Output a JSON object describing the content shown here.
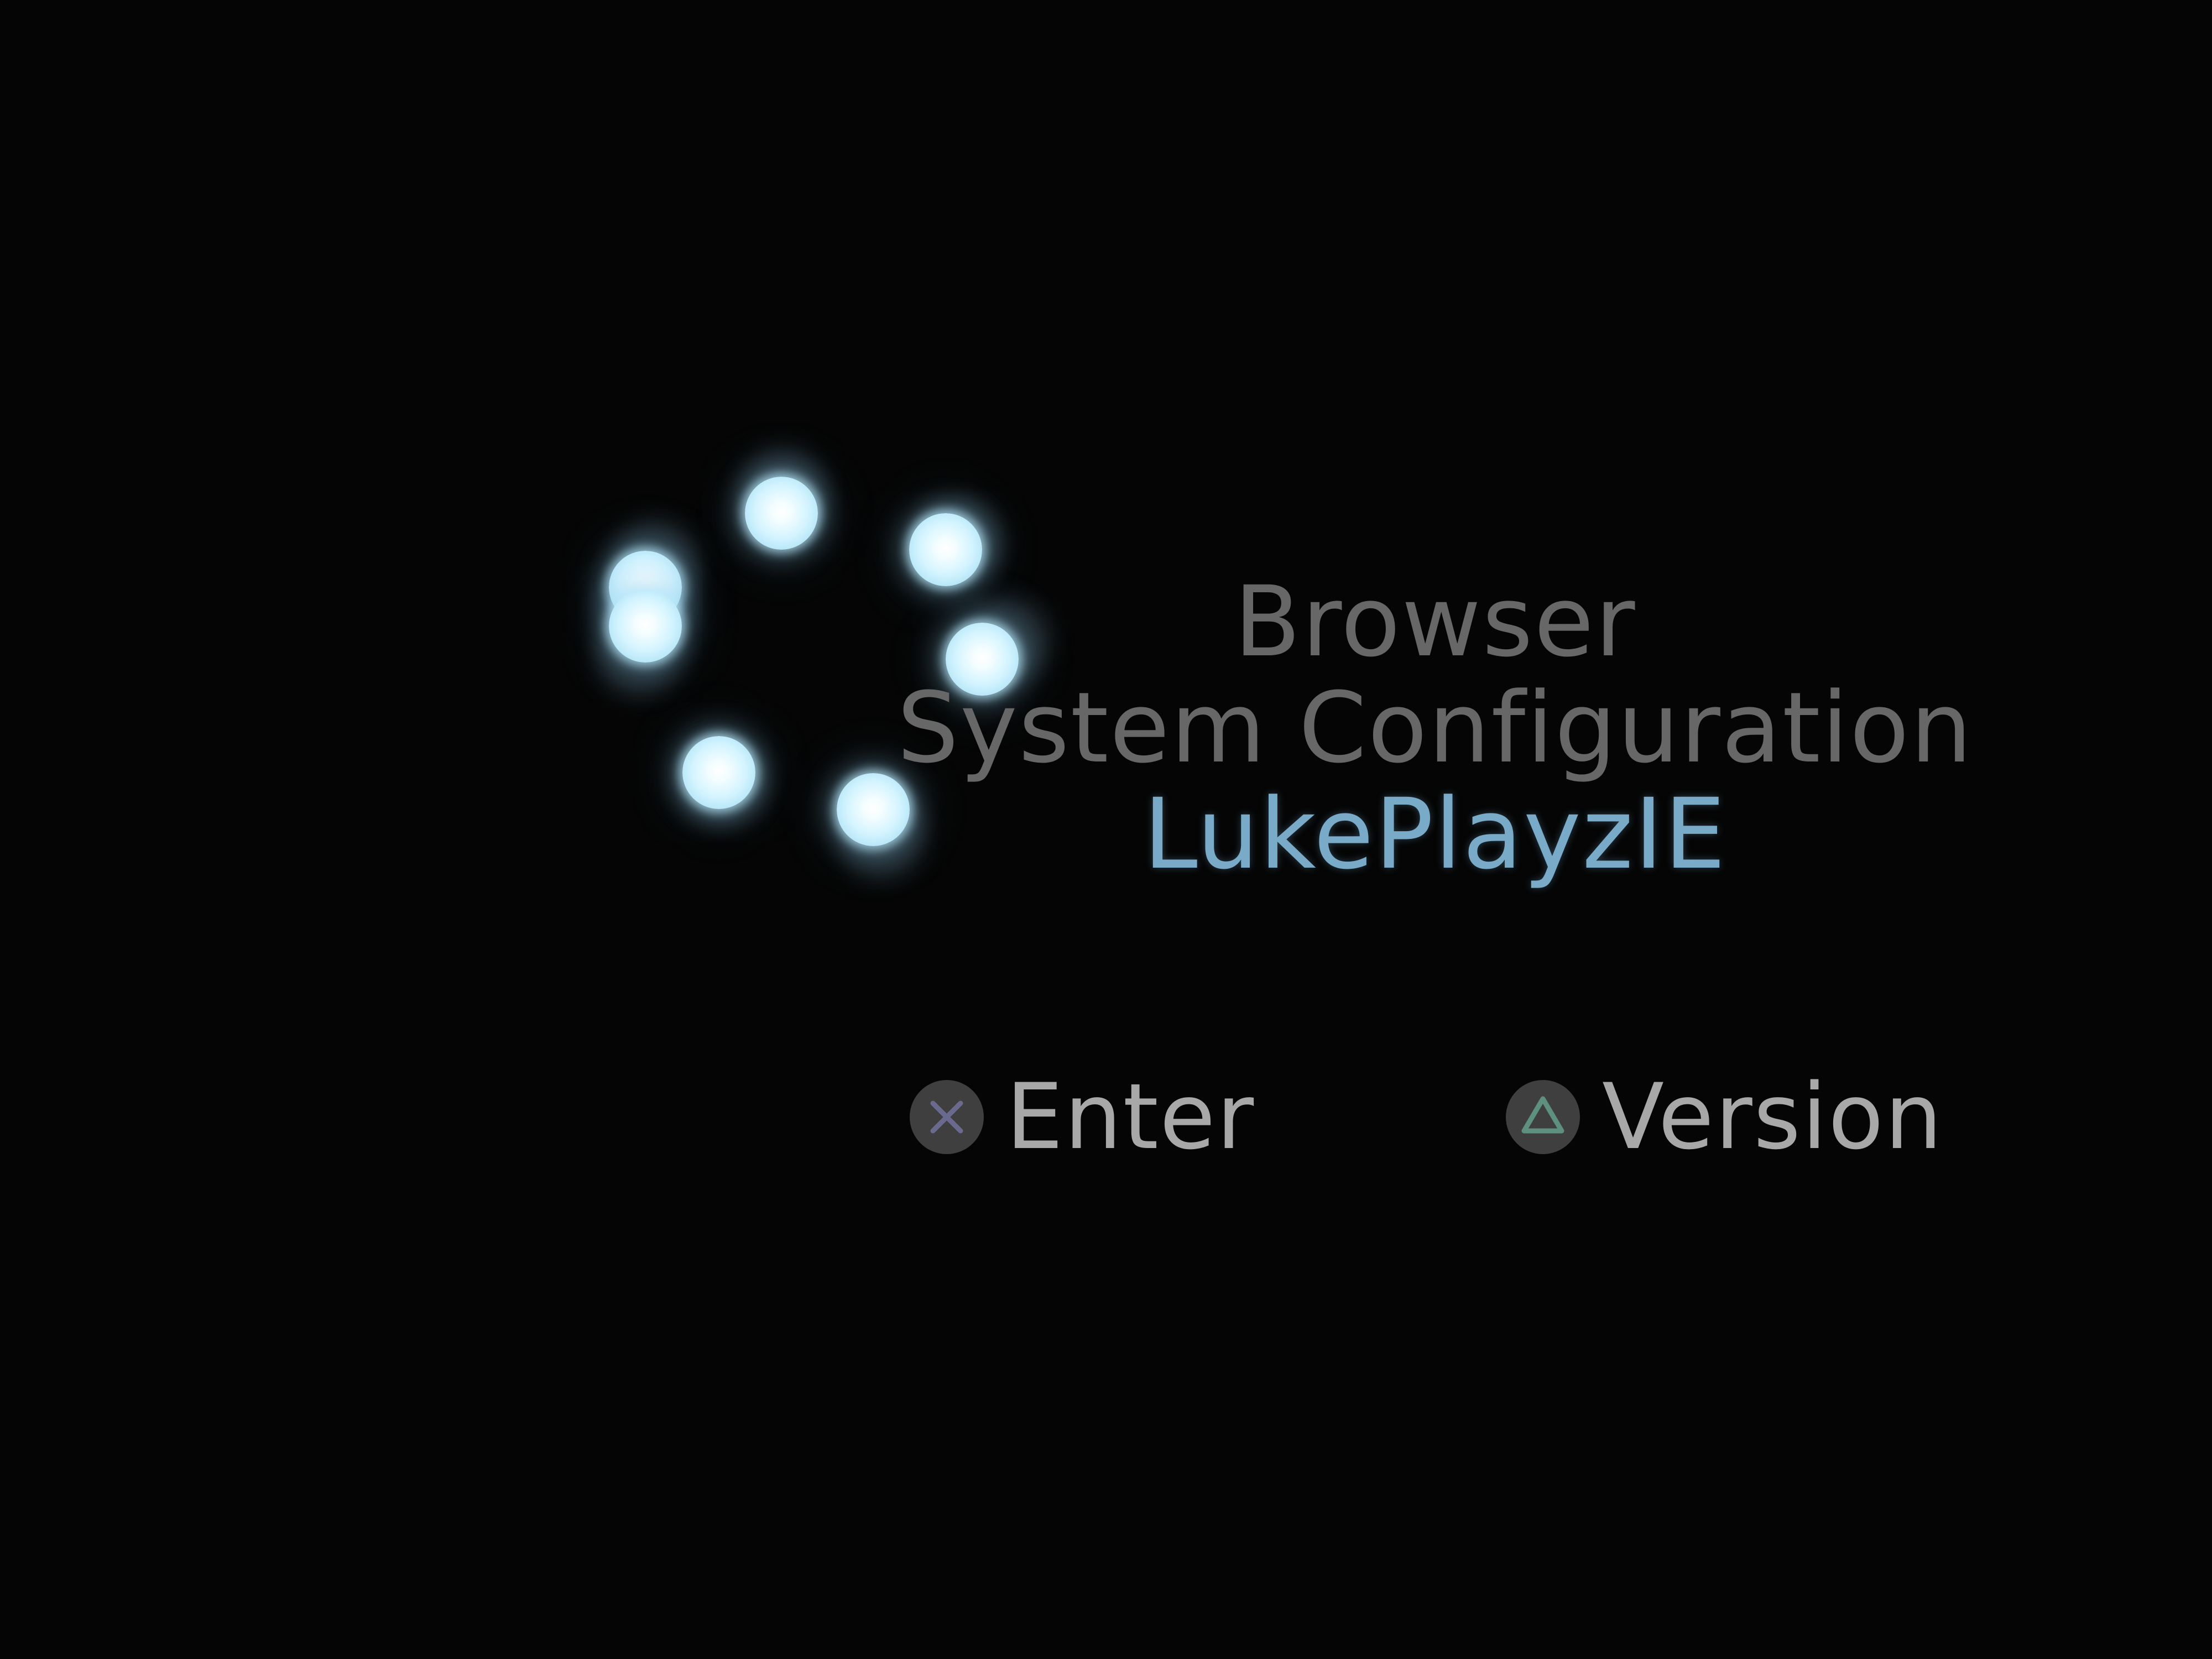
{
  "menu": {
    "items": [
      {
        "label": "Browser",
        "selected": false
      },
      {
        "label": "System Configuration",
        "selected": false
      },
      {
        "label": "LukePlayzIE",
        "selected": true
      }
    ],
    "selected_color": "#79aac8",
    "unselected_color": "#676767"
  },
  "button_hints": [
    {
      "icon": "cross-button-icon",
      "label": "Enter",
      "icon_color": "#6a6a8e"
    },
    {
      "icon": "triangle-button-icon",
      "label": "Version",
      "icon_color": "#5e9080"
    }
  ],
  "spinner": {
    "orb_count": 7,
    "orb_color": "#d4f4ff"
  },
  "background_color": "#050505"
}
